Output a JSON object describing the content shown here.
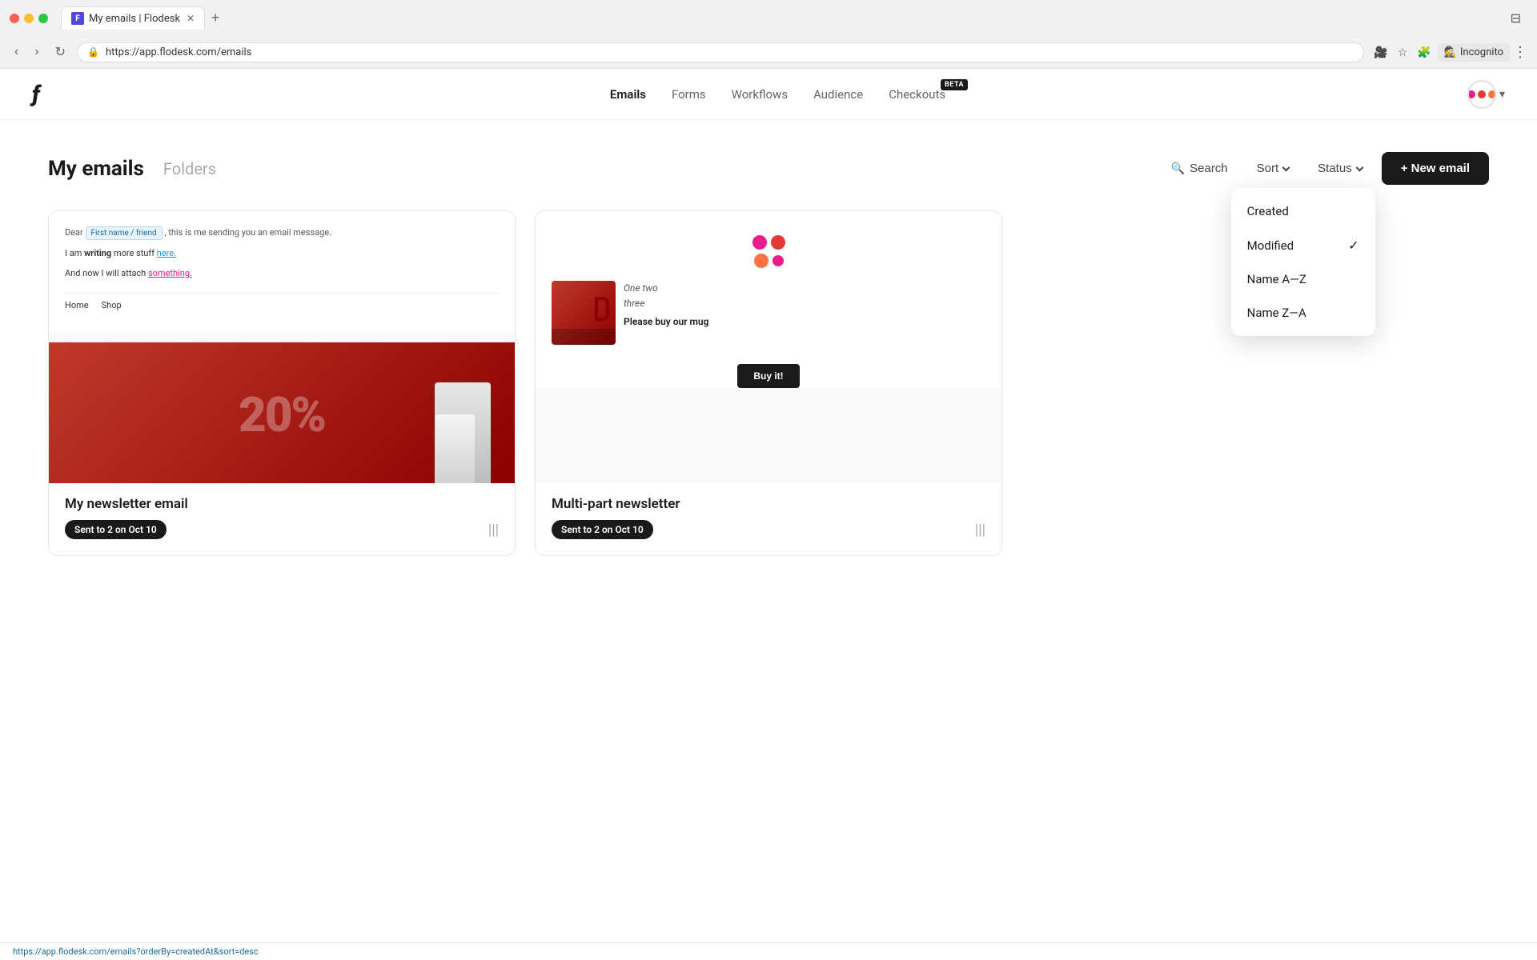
{
  "browser": {
    "tab_title": "My emails | Flodesk",
    "tab_favicon": "F",
    "url": "app.flodesk.com/emails",
    "url_full": "https://app.flodesk.com/emails",
    "nav_back": "‹",
    "nav_forward": "›",
    "nav_refresh": "↻",
    "incognito_label": "Incognito",
    "status_bar_url": "https://app.flodesk.com/emails?orderBy=createdAt&sort=desc"
  },
  "app": {
    "logo": "ƒ",
    "nav_links": [
      {
        "label": "Emails",
        "active": true
      },
      {
        "label": "Forms",
        "active": false
      },
      {
        "label": "Workflows",
        "active": false
      },
      {
        "label": "Audience",
        "active": false
      },
      {
        "label": "Checkouts",
        "active": false,
        "badge": "BETA"
      }
    ]
  },
  "page": {
    "title": "My emails",
    "tab_folders": "Folders",
    "search_label": "Search",
    "sort_label": "Sort",
    "status_label": "Status",
    "new_email_label": "+ New email"
  },
  "sort_dropdown": {
    "items": [
      {
        "label": "Created",
        "checked": false
      },
      {
        "label": "Modified",
        "checked": true
      },
      {
        "label": "Name A—Z",
        "checked": false
      },
      {
        "label": "Name Z—A",
        "checked": false
      }
    ]
  },
  "emails": [
    {
      "id": "email-1",
      "title": "My newsletter email",
      "status": "Sent to 2 on Oct 10",
      "preview_type": "newsletter"
    },
    {
      "id": "email-2",
      "title": "Multi-part newsletter",
      "status": "Sent to 2 on Oct 10",
      "preview_type": "multipart"
    }
  ]
}
